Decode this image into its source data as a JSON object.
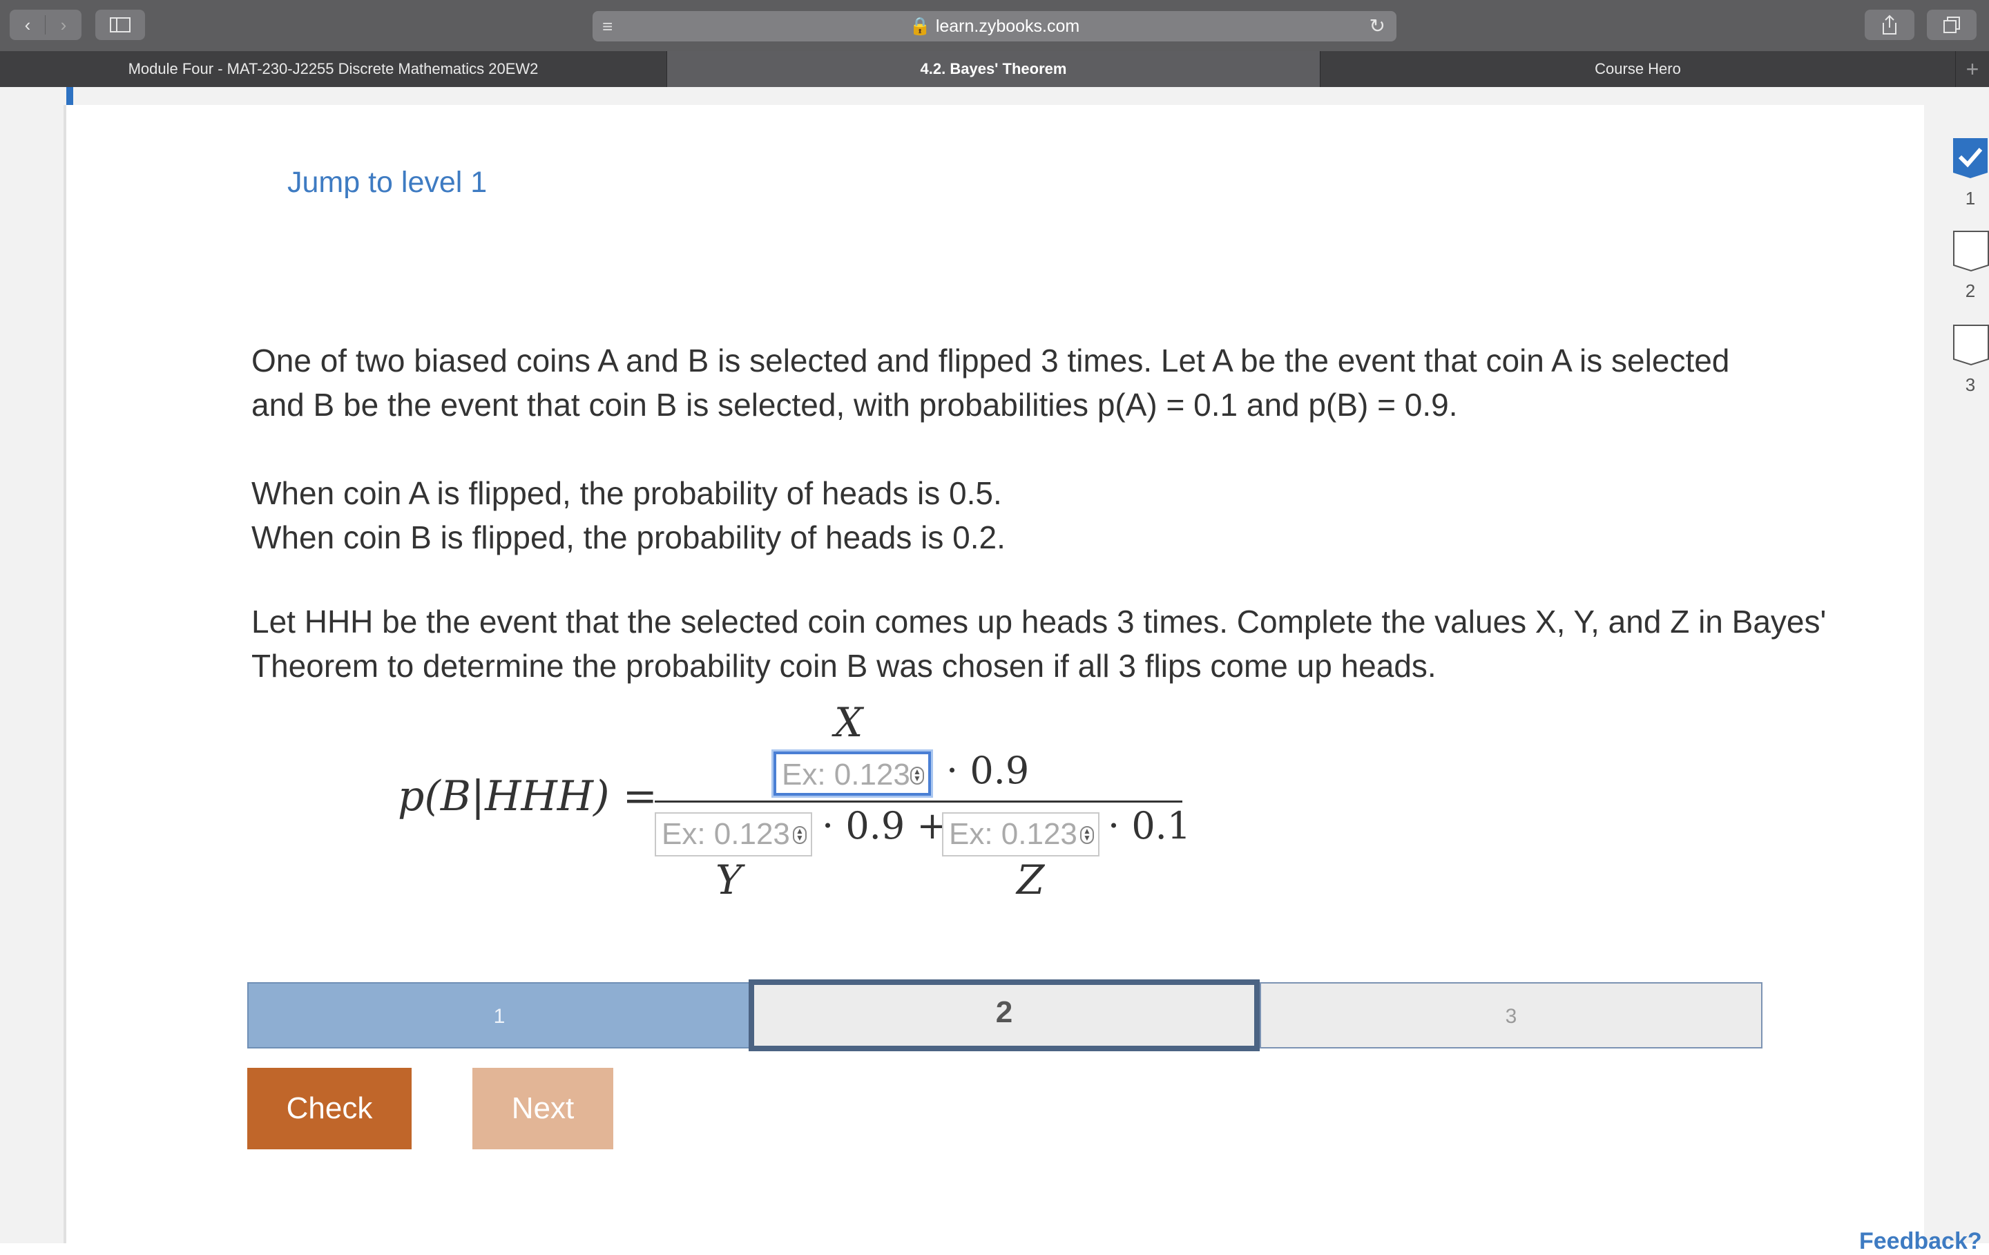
{
  "browser": {
    "url": "learn.zybooks.com",
    "tabs": [
      {
        "label": "Module Four - MAT-230-J2255 Discrete Mathematics 20EW2"
      },
      {
        "label": "4.2. Bayes' Theorem"
      },
      {
        "label": "Course Hero"
      }
    ],
    "icons": {
      "back": "chevron-left-icon",
      "forward": "chevron-right-icon",
      "sidebar": "sidebar-icon",
      "reader": "reader-icon",
      "lock": "lock-icon",
      "reload": "reload-icon",
      "share": "share-icon",
      "tabs": "tabs-icon",
      "new_tab": "plus-icon"
    }
  },
  "activity": {
    "jump_link": "Jump to level 1",
    "paragraph1": "One of two biased coins A and B is selected and flipped 3 times. Let A be the event that coin A is selected and B be the event that coin B is selected, with probabilities p(A) = 0.1 and p(B) = 0.9.",
    "paragraph2_line1": "When coin A is flipped, the probability of heads is 0.5.",
    "paragraph2_line2": "When coin B is flipped, the probability of heads is 0.2.",
    "paragraph3": "Let HHH be the event that the selected coin comes up heads 3 times. Complete the values X, Y, and Z in Bayes' Theorem to determine the probability coin B was chosen if all 3 flips come up heads."
  },
  "equation": {
    "lhs": "p(B|HHH) =",
    "var_x": "X",
    "var_y": "Y",
    "var_z": "Z",
    "numerator_factor": "· 0.9",
    "denominator_factor1": "· 0.9 +",
    "denominator_factor2": "· 0.1",
    "input_placeholder": "Ex: 0.123"
  },
  "levels": {
    "items": [
      "1",
      "2",
      "3"
    ],
    "current": 2,
    "completed": [
      1
    ]
  },
  "buttons": {
    "check": "Check",
    "next": "Next"
  },
  "feedback_link": "Feedback?",
  "level_rail": {
    "items": [
      {
        "label": "1",
        "completed": true
      },
      {
        "label": "2",
        "completed": false
      },
      {
        "label": "3",
        "completed": false
      }
    ]
  },
  "colors": {
    "accent_blue": "#3e7bc2",
    "check_button": "#c0662a",
    "next_button_disabled": "#e2b596",
    "level_completed": "#8eaed2",
    "level_current_border": "#4b6383"
  }
}
